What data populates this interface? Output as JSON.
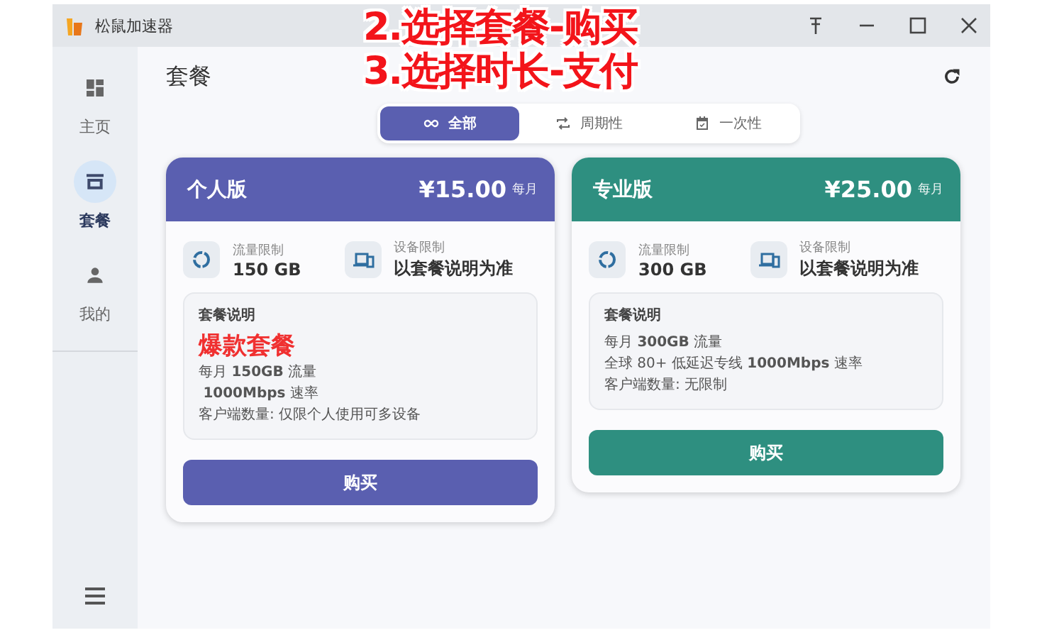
{
  "window": {
    "title": "松鼠加速器"
  },
  "annotation": [
    "2.选择套餐-购买",
    "3.选择时长-支付"
  ],
  "sidebar": {
    "items": [
      {
        "label": "主页",
        "selected": false
      },
      {
        "label": "套餐",
        "selected": true
      },
      {
        "label": "我的",
        "selected": false
      }
    ]
  },
  "page": {
    "title": "套餐"
  },
  "tabs": [
    {
      "label": "全部",
      "selected": true
    },
    {
      "label": "周期性",
      "selected": false
    },
    {
      "label": "一次性",
      "selected": false
    }
  ],
  "plans": [
    {
      "name": "个人版",
      "price": "¥15.00",
      "period": "每月",
      "color": "#5a5fb0",
      "traffic_label": "流量限制",
      "traffic": "150 GB",
      "device_label": "设备限制",
      "device": "以套餐说明为准",
      "desc_title": "套餐说明",
      "lines": [
        {
          "kind": "highlight",
          "text": "爆款套餐"
        },
        {
          "kind": "text",
          "text": "每月 **150GB** 流量"
        },
        {
          "kind": "text",
          "text": " **1000Mbps** 速率"
        },
        {
          "kind": "text",
          "text": "客户端数量: 仅限个人使用可多设备"
        }
      ],
      "button": "购买"
    },
    {
      "name": "专业版",
      "price": "¥25.00",
      "period": "每月",
      "color": "#2e8f80",
      "traffic_label": "流量限制",
      "traffic": "300 GB",
      "device_label": "设备限制",
      "device": "以套餐说明为准",
      "desc_title": "套餐说明",
      "lines": [
        {
          "kind": "text",
          "text": "每月 **300GB** 流量"
        },
        {
          "kind": "text",
          "text": "全球 80+ 低延迟专线 **1000Mbps** 速率"
        },
        {
          "kind": "text",
          "text": "客户端数量: 无限制"
        }
      ],
      "button": "购买"
    }
  ]
}
